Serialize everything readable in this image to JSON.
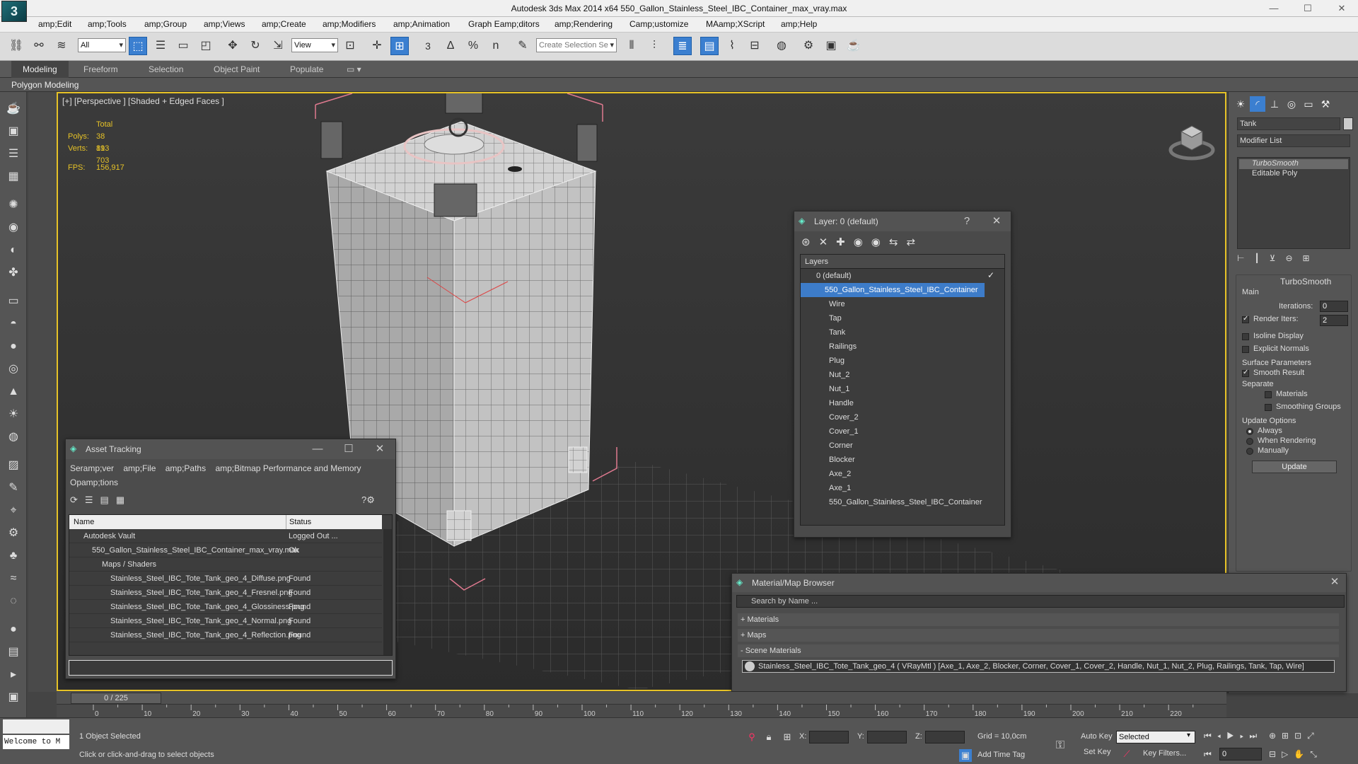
{
  "window": {
    "logo": "3",
    "title": "Autodesk 3ds Max  2014 x64     550_Gallon_Stainless_Steel_IBC_Container_max_vray.max",
    "min": "—",
    "max": "☐",
    "close": "✕"
  },
  "menu": [
    "amp;Edit",
    "amp;Tools",
    "amp;Group",
    "amp;Views",
    "amp;Create",
    "amp;Modifiers",
    "amp;Animation",
    "Graph Eamp;ditors",
    "amp;Rendering",
    "Camp;ustomize",
    "MAamp;XScript",
    "amp;Help"
  ],
  "toolbar": {
    "filter_value": "All",
    "refcoord_value": "View",
    "named_sel_placeholder": "Create Selection Se",
    "snap_label": "3",
    "angle_snap_label": "∆",
    "percent_snap_label": "%",
    "spinner_snap_label": "n"
  },
  "ribbon": {
    "tabs": [
      "Modeling",
      "Freeform",
      "Selection",
      "Object Paint",
      "Populate"
    ],
    "extra": "▭ ▾",
    "sub": "Polygon Modeling"
  },
  "viewport": {
    "label": "[+] [Perspective ] [Shaded + Edged Faces ]",
    "total_label": "Total",
    "polys_label": "Polys:",
    "polys_value": "38 813",
    "verts_label": "Verts:",
    "verts_value": "19 703",
    "fps_label": "FPS:",
    "fps_value": "156,917"
  },
  "command_panel": {
    "object_name": "Tank",
    "modifier_list": "Modifier List",
    "stack": [
      "TurboSmooth",
      "Editable Poly"
    ],
    "rollout_title": "TurboSmooth",
    "main_label": "Main",
    "iterations_label": "Iterations:",
    "iterations_value": "0",
    "render_iters_label": "Render Iters:",
    "render_iters_value": "2",
    "isoline_label": "Isoline Display",
    "explicit_normals_label": "Explicit Normals",
    "surface_params_label": "Surface Parameters",
    "smooth_result_label": "Smooth Result",
    "separate_label": "Separate",
    "materials_label": "Materials",
    "smoothing_groups_label": "Smoothing Groups",
    "update_options_label": "Update Options",
    "always_label": "Always",
    "when_rendering_label": "When Rendering",
    "manually_label": "Manually",
    "update_button": "Update"
  },
  "layer_panel": {
    "title": "Layer: 0 (default)",
    "help": "?",
    "column": "Layers",
    "default_layer": "0 (default)",
    "selected_layer": "550_Gallon_Stainless_Steel_IBC_Container",
    "children": [
      "Wire",
      "Tap",
      "Tank",
      "Railings",
      "Plug",
      "Nut_2",
      "Nut_1",
      "Handle",
      "Cover_2",
      "Cover_1",
      "Corner",
      "Blocker",
      "Axe_2",
      "Axe_1",
      "550_Gallon_Stainless_Steel_IBC_Container"
    ]
  },
  "asset_panel": {
    "title": "Asset Tracking",
    "menu": [
      "Seramp;ver",
      "amp;File",
      "amp;Paths",
      "amp;Bitmap Performance and Memory",
      "Opamp;tions"
    ],
    "col_name": "Name",
    "col_status": "Status",
    "rows": [
      {
        "name": "Autodesk Vault",
        "status": "Logged Out ..."
      },
      {
        "name": "550_Gallon_Stainless_Steel_IBC_Container_max_vray.max",
        "status": "Ok"
      },
      {
        "name": "Maps / Shaders",
        "status": ""
      },
      {
        "name": "Stainless_Steel_IBC_Tote_Tank_geo_4_Diffuse.png",
        "status": "Found"
      },
      {
        "name": "Stainless_Steel_IBC_Tote_Tank_geo_4_Fresnel.png",
        "status": "Found"
      },
      {
        "name": "Stainless_Steel_IBC_Tote_Tank_geo_4_Glossiness.png",
        "status": "Found"
      },
      {
        "name": "Stainless_Steel_IBC_Tote_Tank_geo_4_Normal.png",
        "status": "Found"
      },
      {
        "name": "Stainless_Steel_IBC_Tote_Tank_geo_4_Reflection.png",
        "status": "Found"
      }
    ]
  },
  "material_browser": {
    "title": "Material/Map Browser",
    "search_placeholder": "Search by Name ...",
    "materials": "+ Materials",
    "maps": "+ Maps",
    "scene_materials": "- Scene Materials",
    "scene_entry": "Stainless_Steel_IBC_Tote_Tank_geo_4  ( VRayMtl ) [Axe_1, Axe_2, Blocker, Corner, Cover_1, Cover_2, Handle, Nut_1, Nut_2, Plug, Railings, Tank, Tap, Wire]"
  },
  "timeline": {
    "frame": "0 / 225",
    "ticks": [
      "0",
      "10",
      "20",
      "30",
      "40",
      "50",
      "60",
      "70",
      "80",
      "90",
      "100",
      "110",
      "120",
      "130",
      "140",
      "150",
      "160",
      "170",
      "180",
      "190",
      "200",
      "210",
      "220"
    ]
  },
  "status": {
    "maxscript": "Welcome to M",
    "selected": "1 Object Selected",
    "prompt": "Click or click-and-drag to select objects",
    "x_label": "X:",
    "y_label": "Y:",
    "z_label": "Z:",
    "grid": "Grid = 10,0cm",
    "add_time_tag": "Add Time Tag",
    "auto_key": "Auto Key",
    "set_key": "Set Key",
    "selected_dropdown": "Selected",
    "key_filters": "Key Filters...",
    "frame_value": "0"
  }
}
